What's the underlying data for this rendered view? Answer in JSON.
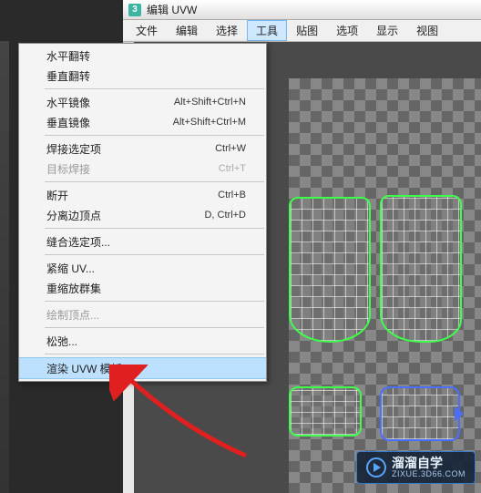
{
  "app_icon": "3",
  "title": "编辑 UVW",
  "menubar": [
    "文件",
    "编辑",
    "选择",
    "工具",
    "贴图",
    "选项",
    "显示",
    "视图"
  ],
  "active_menu_index": 3,
  "dropdown": [
    {
      "label": "水平翻转",
      "shortcut": "",
      "type": "item"
    },
    {
      "label": "垂直翻转",
      "shortcut": "",
      "type": "item"
    },
    {
      "type": "sep"
    },
    {
      "label": "水平镜像",
      "shortcut": "Alt+Shift+Ctrl+N",
      "type": "item"
    },
    {
      "label": "垂直镜像",
      "shortcut": "Alt+Shift+Ctrl+M",
      "type": "item"
    },
    {
      "type": "sep"
    },
    {
      "label": "焊接选定项",
      "shortcut": "Ctrl+W",
      "type": "item"
    },
    {
      "label": "目标焊接",
      "shortcut": "Ctrl+T",
      "type": "item",
      "disabled": true
    },
    {
      "type": "sep"
    },
    {
      "label": "断开",
      "shortcut": "Ctrl+B",
      "type": "item"
    },
    {
      "label": "分离边顶点",
      "shortcut": "D, Ctrl+D",
      "type": "item"
    },
    {
      "type": "sep"
    },
    {
      "label": "缝合选定项...",
      "shortcut": "",
      "type": "item"
    },
    {
      "type": "sep"
    },
    {
      "label": "紧缩 UV...",
      "shortcut": "",
      "type": "item"
    },
    {
      "label": "重缩放群集",
      "shortcut": "",
      "type": "item"
    },
    {
      "type": "sep"
    },
    {
      "label": "绘制顶点...",
      "shortcut": "",
      "type": "item",
      "disabled": true
    },
    {
      "type": "sep"
    },
    {
      "label": "松弛...",
      "shortcut": "",
      "type": "item"
    },
    {
      "type": "sep"
    },
    {
      "label": "渲染 UVW 模板...",
      "shortcut": "",
      "type": "item",
      "highlight": true
    }
  ],
  "watermark": {
    "brand": "溜溜自学",
    "url": "ZIXUE.3D66.COM"
  }
}
